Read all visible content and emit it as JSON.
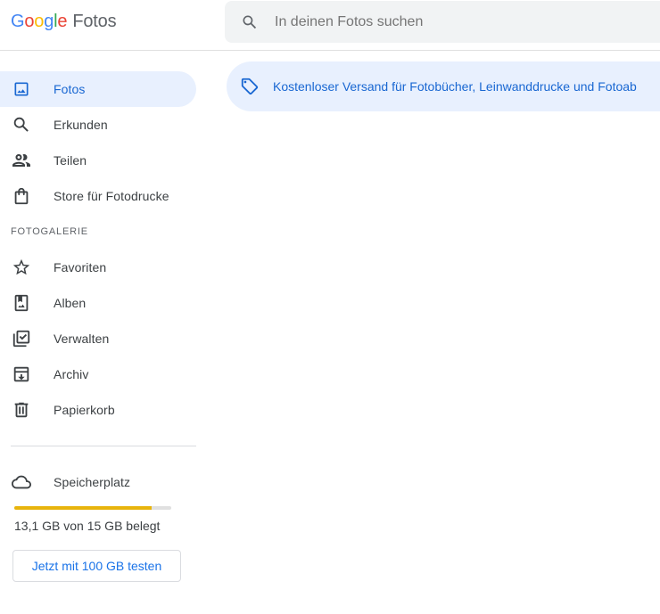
{
  "app": {
    "logo_letters": [
      "G",
      "o",
      "o",
      "g",
      "l",
      "e"
    ],
    "product": "Fotos"
  },
  "search": {
    "placeholder": "In deinen Fotos suchen",
    "icon": "search-icon"
  },
  "nav": {
    "primary": [
      {
        "label": "Fotos",
        "icon": "photo-icon",
        "active": true
      },
      {
        "label": "Erkunden",
        "icon": "search-icon"
      },
      {
        "label": "Teilen",
        "icon": "people-icon"
      },
      {
        "label": "Store für Fotodrucke",
        "icon": "shopping-bag-icon"
      }
    ],
    "section_label": "FOTOGALERIE",
    "library": [
      {
        "label": "Favoriten",
        "icon": "star-icon"
      },
      {
        "label": "Alben",
        "icon": "album-icon"
      },
      {
        "label": "Verwalten",
        "icon": "manage-icon"
      },
      {
        "label": "Archiv",
        "icon": "archive-icon"
      },
      {
        "label": "Papierkorb",
        "icon": "trash-icon"
      }
    ],
    "storage": {
      "label": "Speicherplatz",
      "icon": "cloud-icon"
    }
  },
  "storage": {
    "used_text": "13,1 GB von 15 GB belegt",
    "used_fraction": 0.873,
    "bar_color": "#e8b40c",
    "upgrade_label": "Jetzt mit 100 GB testen"
  },
  "banner": {
    "icon": "tag-icon",
    "text": "Kostenloser Versand für Fotobücher, Leinwanddrucke und Fotoab"
  },
  "colors": {
    "accent": "#1967d2",
    "active_bg": "#e8f0fe",
    "search_bg": "#f1f3f4"
  }
}
